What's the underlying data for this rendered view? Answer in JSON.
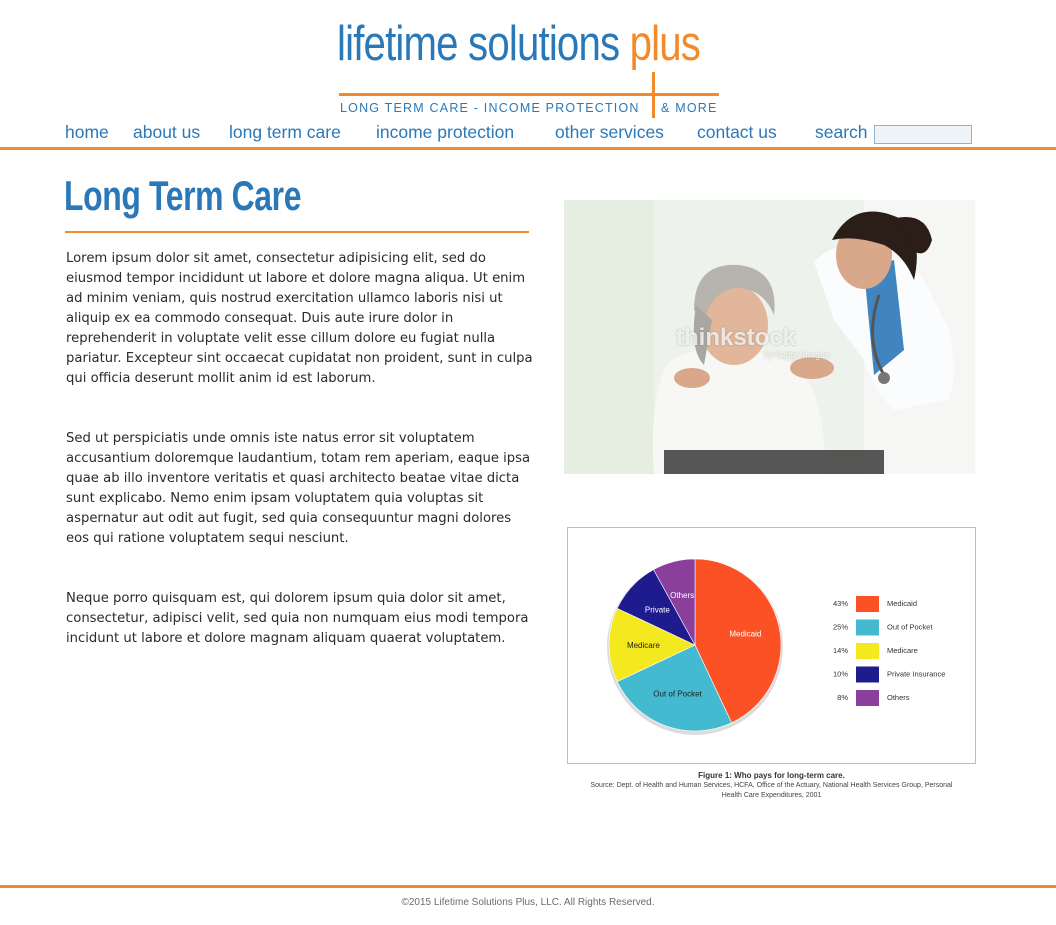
{
  "logo": {
    "word1": "lifetime solutions ",
    "word2": "plus",
    "tagline": "LONG TERM CARE - INCOME PROTECTION",
    "tagline_suffix": "& MORE"
  },
  "nav": {
    "items": [
      {
        "label": "home"
      },
      {
        "label": "about us"
      },
      {
        "label": "long term care"
      },
      {
        "label": "income protection"
      },
      {
        "label": "other services"
      },
      {
        "label": "contact us"
      }
    ],
    "search_label": "search",
    "search_value": ""
  },
  "main": {
    "title": "Long Term Care",
    "paragraphs": [
      "Lorem ipsum dolor sit amet, consectetur adipisicing elit, sed do eiusmod tempor incididunt ut labore et dolore magna aliqua. Ut enim ad minim veniam, quis nostrud exercitation ullamco laboris nisi ut aliquip ex ea commodo consequat. Duis aute irure dolor in reprehenderit in voluptate velit esse cillum dolore eu fugiat nulla pariatur. Excepteur sint occaecat cupidatat non proident, sunt in culpa qui officia deserunt mollit anim id est laborum.",
      "Sed ut perspiciatis unde omnis iste natus error sit voluptatem accusantium doloremque laudantium, totam rem aperiam, eaque ipsa quae ab illo inventore veritatis et quasi architecto beatae vitae dicta sunt explicabo. Nemo enim ipsam voluptatem quia voluptas sit aspernatur aut odit aut fugit, sed quia consequuntur magni dolores eos qui ratione voluptatem sequi nesciunt.",
      "Neque porro quisquam est, qui dolorem ipsum quia dolor sit amet, consectetur, adipisci velit, sed quia non numquam eius modi tempora incidunt ut labore et dolore magnam aliquam quaerat voluptatem."
    ]
  },
  "photo": {
    "watermark": "thinkstock",
    "watermark_sub": "by Getty Images"
  },
  "chart_data": {
    "type": "pie",
    "slices": [
      {
        "label": "Medicaid",
        "slice_label": "Medicaid",
        "value": 43,
        "pct_label": "43%",
        "color": "#fb5124"
      },
      {
        "label": "Out of Pocket",
        "slice_label": "Out of Pocket",
        "value": 25,
        "pct_label": "25%",
        "color": "#43bad0"
      },
      {
        "label": "Medicare",
        "slice_label": "Medicare",
        "value": 14,
        "pct_label": "14%",
        "color": "#f4e81e"
      },
      {
        "label": "Private Insurance",
        "slice_label": "Private",
        "value": 10,
        "pct_label": "10%",
        "color": "#1e1b8f"
      },
      {
        "label": "Others",
        "slice_label": "Others",
        "value": 8,
        "pct_label": "8%",
        "color": "#8a3f9d"
      }
    ],
    "legend_position": "right"
  },
  "caption": {
    "title": "Figure 1: Who pays for long-term care.",
    "source": "Source: Dept. of Health and Human Services, HCFA, Office of the Actuary, National Health Services Group, Personal Health Care Expenditures, 2001"
  },
  "footer": {
    "copyright": "©2015 Lifetime Solutions Plus, LLC. All Rights Reserved."
  },
  "colors": {
    "brand_blue": "#2a78b8",
    "brand_orange": "#f28a2a"
  }
}
